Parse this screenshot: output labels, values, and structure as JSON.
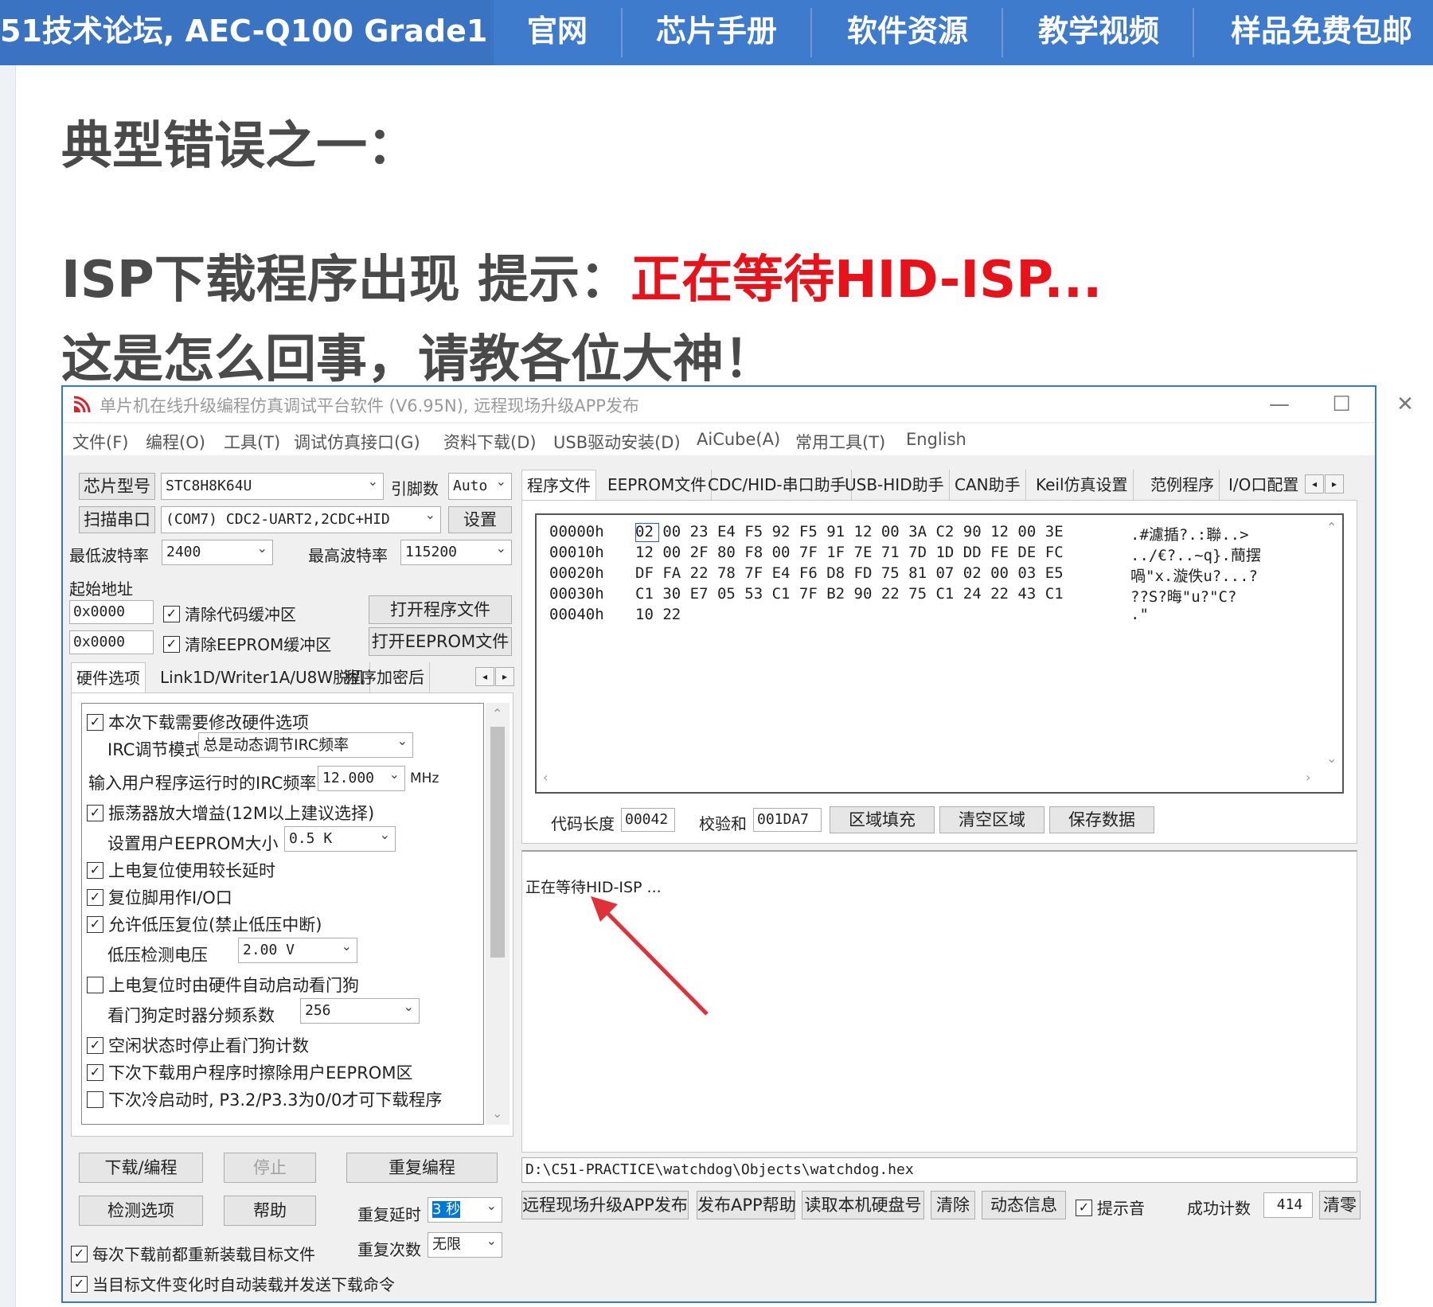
{
  "banner": {
    "site_text": "51技术论坛, AEC-Q100 Grade1",
    "nav": [
      "官网",
      "芯片手册",
      "软件资源",
      "教学视频",
      "样品免费包邮"
    ]
  },
  "post": {
    "heading1": "典型错误之一：",
    "heading2_prefix": "ISP下载程序出现 提示：",
    "heading2_red": "正在等待HID-ISP...",
    "heading3": "这是怎么回事，请教各位大神！"
  },
  "window": {
    "title": "单片机在线升级编程仿真调试平台软件 (V6.95N), 远程现场升级APP发布",
    "controls": {
      "minimize": "—",
      "maximize": "☐",
      "close": "✕"
    },
    "menu": [
      "文件(F)",
      "编程(O)",
      "工具(T)",
      "调试仿真接口(G)",
      "资料下载(D)",
      "USB驱动安装(D)",
      "AiCube(A)",
      "常用工具(T)",
      "English"
    ],
    "chip_btn": "芯片型号",
    "chip_value": "STC8H8K64U",
    "pins_label": "引脚数",
    "pins_value": "Auto",
    "scan_btn": "扫描串口",
    "port_value": "(COM7) CDC2-UART2,2CDC+HID",
    "settings_btn": "设置",
    "min_baud_label": "最低波特率",
    "min_baud_value": "2400",
    "max_baud_label": "最高波特率",
    "max_baud_value": "115200",
    "start_addr_label": "起始地址",
    "addr1": "0x0000",
    "clear_code": "清除代码缓冲区",
    "open_prog_btn": "打开程序文件",
    "addr2": "0x0000",
    "clear_eeprom": "清除EEPROM缓冲区",
    "open_eeprom_btn": "打开EEPROM文件",
    "left_tabs": [
      "硬件选项",
      "Link1D/Writer1A/U8W脱机",
      "程序加密后"
    ],
    "options": {
      "o1": "本次下载需要修改硬件选项",
      "irc_mode_label": "IRC调节模式",
      "irc_mode_value": "总是动态调节IRC频率",
      "irc_freq_label": "输入用户程序运行时的IRC频率",
      "irc_freq_value": "12.000",
      "irc_freq_unit": "MHz",
      "o2": "振荡器放大增益(12M以上建议选择)",
      "eeprom_size_label": "设置用户EEPROM大小",
      "eeprom_size_value": "0.5 K",
      "o3": "上电复位使用较长延时",
      "o4": "复位脚用作I/O口",
      "o5": "允许低压复位(禁止低压中断)",
      "lv_label": "低压检测电压",
      "lv_value": "2.00 V",
      "o6": "上电复位时由硬件自动启动看门狗",
      "wdt_label": "看门狗定时器分频系数",
      "wdt_value": "256",
      "o7": "空闲状态时停止看门狗计数",
      "o8": "下次下载用户程序时擦除用户EEPROM区",
      "o9": "下次冷启动时, P3.2/P3.3为0/0才可下载程序"
    },
    "download_btn": "下载/编程",
    "stop_btn": "停止",
    "reprogram_btn": "重复编程",
    "check_btn": "检测选项",
    "help_btn": "帮助",
    "repeat_delay_label": "重复延时",
    "repeat_delay_value": "3 秒",
    "repeat_count_label": "重复次数",
    "repeat_count_value": "无限",
    "reload_each": "每次下载前都重新装载目标文件",
    "auto_reload": "当目标文件变化时自动装载并发送下载命令",
    "right_tabs": [
      "程序文件",
      "EEPROM文件",
      "CDC/HID-串口助手",
      "USB-HID助手",
      "CAN助手",
      "Keil仿真设置",
      "范例程序",
      "I/O口配置"
    ],
    "hex": [
      {
        "addr": "00000h",
        "bytes": "02 00 23 E4 F5 92 F5 91 12 00 3A C2 90 12 00 3E",
        "ascii": ".#濾揗?.:聯..>"
      },
      {
        "addr": "00010h",
        "bytes": "12 00 2F 80 F8 00 7F 1F 7E 71 7D 1D DD FE DE FC",
        "ascii": "../€?..~q}.蕳摆"
      },
      {
        "addr": "00020h",
        "bytes": "DF FA 22 78 7F E4 F6 D8 FD 75 81 07 02 00 03 E5",
        "ascii": "喎\"x.漩佚u?...?"
      },
      {
        "addr": "00030h",
        "bytes": "C1 30 E7 05 53 C1 7F B2 90 22 75 C1 24 22 43 C1",
        "ascii": "??S?晦\"u?\"C?"
      },
      {
        "addr": "00040h",
        "bytes": "10 22",
        "ascii": ".\""
      }
    ],
    "code_len_label": "代码长度",
    "code_len_value": "00042",
    "checksum_label": "校验和",
    "checksum_value": "001DA7",
    "fill_btn": "区域填充",
    "clear_area_btn": "清空区域",
    "save_btn": "保存数据",
    "status_text": "正在等待HID-ISP ...",
    "file_path": "D:\\C51-PRACTICE\\watchdog\\Objects\\watchdog.hex",
    "bottom": {
      "remote_btn": "远程现场升级APP发布",
      "app_help_btn": "发布APP帮助",
      "read_disk_btn": "读取本机硬盘号",
      "clear_btn": "清除",
      "dynamic_btn": "动态信息",
      "sound_label": "提示音",
      "success_label": "成功计数",
      "success_value": "414",
      "reset_btn": "清零"
    }
  },
  "colors": {
    "banner": "#3f7bcc",
    "accent_red": "#e8121b",
    "window_border": "#2f7ad0",
    "arrow": "#e0303a"
  }
}
